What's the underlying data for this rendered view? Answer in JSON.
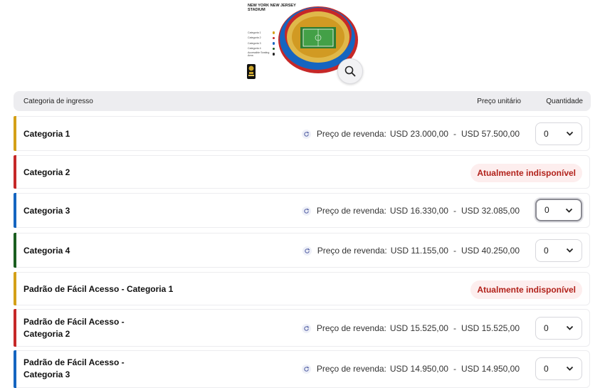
{
  "map": {
    "title_line1": "NEW YORK NEW JERSEY",
    "title_line2": "STADIUM",
    "legend": [
      {
        "label": "Categoria 1",
        "color": "#d4a017"
      },
      {
        "label": "Categoria 2",
        "color": "#c62828"
      },
      {
        "label": "Categoria 3",
        "color": "#1565c0"
      },
      {
        "label": "Categoria 4",
        "color": "#1b5e20"
      },
      {
        "label": "Accessible Seating Area",
        "color": "#222222"
      }
    ],
    "zoom_icon": "search-icon"
  },
  "table": {
    "col_category": "Categoria de ingresso",
    "col_price": "Preço unitário",
    "col_quantity": "Quantidade"
  },
  "rows": [
    {
      "name": "Categoria 1",
      "color": "#d4a017",
      "available": true,
      "price_label": "Preço de revenda:",
      "price_min": "USD 23.000,00",
      "price_max": "USD 57.500,00",
      "quantity": "0"
    },
    {
      "name": "Categoria 2",
      "color": "#c62828",
      "available": false,
      "status": "Atualmente indisponível"
    },
    {
      "name": "Categoria 3",
      "color": "#1565c0",
      "available": true,
      "price_label": "Preço de revenda:",
      "price_min": "USD 16.330,00",
      "price_max": "USD 32.085,00",
      "quantity": "0",
      "focused": true
    },
    {
      "name": "Categoria 4",
      "color": "#1b5e20",
      "available": true,
      "price_label": "Preço de revenda:",
      "price_min": "USD 11.155,00",
      "price_max": "USD 40.250,00",
      "quantity": "0"
    },
    {
      "name": "Padrão de Fácil Acesso - Categoria 1",
      "color": "#d4a017",
      "available": false,
      "status": "Atualmente indisponível"
    },
    {
      "name_line1": "Padrão de Fácil Acesso -",
      "name_line2": "Categoria 2",
      "color": "#c62828",
      "available": true,
      "price_label": "Preço de revenda:",
      "price_min": "USD 15.525,00",
      "price_max": "USD 15.525,00",
      "quantity": "0"
    },
    {
      "name_line1": "Padrão de Fácil Acesso -",
      "name_line2": "Categoria 3",
      "color": "#1565c0",
      "available": true,
      "price_label": "Preço de revenda:",
      "price_min": "USD 14.950,00",
      "price_max": "USD 14.950,00",
      "quantity": "0"
    }
  ],
  "separator": "-",
  "icons": {
    "resale": "resale-cycle-icon",
    "dropdown": "chevron-down-icon"
  }
}
